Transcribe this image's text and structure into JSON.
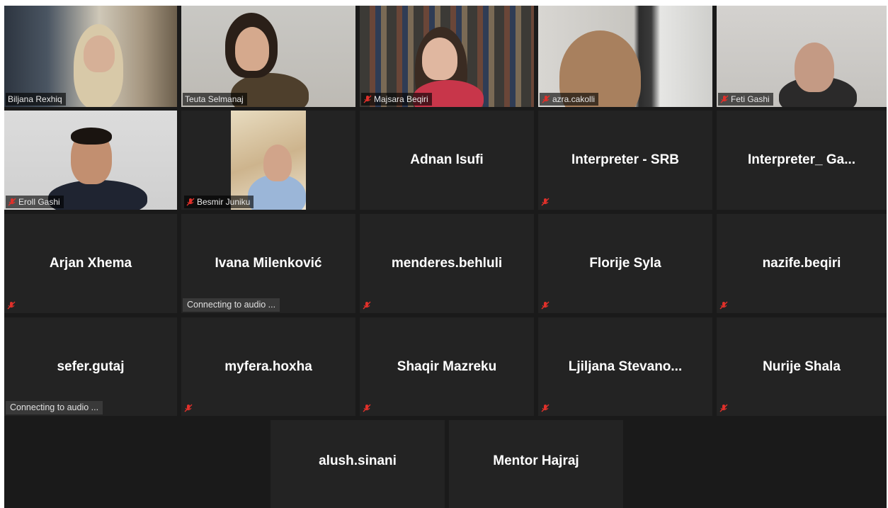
{
  "participants": {
    "video_tiles": [
      {
        "name": "Biljana Rexhiq"
      },
      {
        "name": "Teuta Selmanaj"
      },
      {
        "name": "Majsara Beqiri"
      },
      {
        "name": "azra.cakolli"
      },
      {
        "name": "Feti Gashi"
      },
      {
        "name": "Eroll Gashi"
      },
      {
        "name": "Besmir Juniku"
      }
    ],
    "audio_tiles": [
      {
        "name": "Adnan Isufi"
      },
      {
        "name": "Interpreter - SRB"
      },
      {
        "name": "Interpreter_ Ga..."
      },
      {
        "name": "Arjan Xhema"
      },
      {
        "name": "Ivana Milenković",
        "status": "Connecting to audio ..."
      },
      {
        "name": "menderes.behluli"
      },
      {
        "name": "Florije Syla"
      },
      {
        "name": "nazife.beqiri"
      },
      {
        "name": "sefer.gutaj",
        "status": "Connecting to audio ..."
      },
      {
        "name": "myfera.hoxha"
      },
      {
        "name": "Shaqir Mazreku"
      },
      {
        "name": "Ljiljana  Stevano..."
      },
      {
        "name": "Nurije Shala"
      },
      {
        "name": "alush.sinani"
      },
      {
        "name": "Mentor Hajraj"
      }
    ]
  },
  "colors": {
    "tile_bg": "#232323",
    "active_speaker_border": "#c9e86a",
    "muted_icon": "#e0302a"
  },
  "icons": {
    "muted": "mic-muted-icon"
  }
}
